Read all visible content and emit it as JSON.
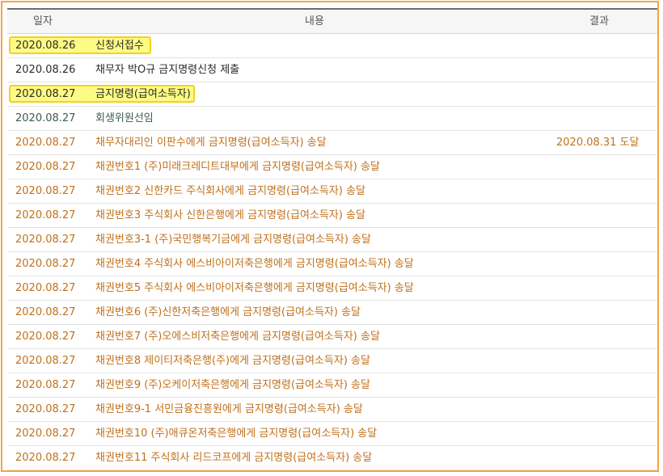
{
  "header": {
    "date": "일자",
    "content": "내용",
    "result": "결과"
  },
  "rows": [
    {
      "date": "2020.08.26",
      "content": "신청서접수",
      "result": ""
    },
    {
      "date": "2020.08.26",
      "content": "채무자 박O규 금지명령신청 제출",
      "result": ""
    },
    {
      "date": "2020.08.27",
      "content": "금지명령(급여소득자)",
      "result": ""
    },
    {
      "date": "2020.08.27",
      "content": "회생위원선임",
      "result": ""
    },
    {
      "date": "2020.08.27",
      "content": "채무자대리인 이판수에게 금지명령(급여소득자) 송달",
      "result": "2020.08.31 도달"
    },
    {
      "date": "2020.08.27",
      "content": "채권번호1 (주)미래크레디트대부에게 금지명령(급여소득자) 송달",
      "result": ""
    },
    {
      "date": "2020.08.27",
      "content": "채권번호2 신한카드 주식회사에게 금지명령(급여소득자) 송달",
      "result": ""
    },
    {
      "date": "2020.08.27",
      "content": "채권번호3 주식회사 신한은행에게 금지명령(급여소득자) 송달",
      "result": ""
    },
    {
      "date": "2020.08.27",
      "content": "채권번호3-1 (주)국민행복기금에게 금지명령(급여소득자) 송달",
      "result": ""
    },
    {
      "date": "2020.08.27",
      "content": "채권번호4 주식회사 에스비아이저축은행에게 금지명령(급여소득자) 송달",
      "result": ""
    },
    {
      "date": "2020.08.27",
      "content": "채권번호5 주식회사 에스비아이저축은행에게 금지명령(급여소득자) 송달",
      "result": ""
    },
    {
      "date": "2020.08.27",
      "content": "채권번호6 (주)신한저축은행에게 금지명령(급여소득자) 송달",
      "result": ""
    },
    {
      "date": "2020.08.27",
      "content": "채권번호7 (주)오에스비저축은행에게 금지명령(급여소득자) 송달",
      "result": ""
    },
    {
      "date": "2020.08.27",
      "content": "채권번호8 제이티저축은행(주)에게 금지명령(급여소득자) 송달",
      "result": ""
    },
    {
      "date": "2020.08.27",
      "content": "채권번호9 (주)오케이저축은행에게 금지명령(급여소득자) 송달",
      "result": ""
    },
    {
      "date": "2020.08.27",
      "content": "채권번호9-1 서민금융진흥원에게 금지명령(급여소득자) 송달",
      "result": ""
    },
    {
      "date": "2020.08.27",
      "content": "채권번호10 (주)애큐온저축은행에게 금지명령(급여소득자) 송달",
      "result": ""
    },
    {
      "date": "2020.08.27",
      "content": "채권번호11 주식회사 리드코프에게 금지명령(급여소득자) 송달",
      "result": ""
    }
  ],
  "colors": {
    "frame_border": "#f4a641",
    "highlight_fill": "#fefb84",
    "highlight_border": "#f2d024",
    "text_dark": "#2a2a2a",
    "text_green": "#3e5b4d",
    "text_orange": "#c0701c"
  }
}
